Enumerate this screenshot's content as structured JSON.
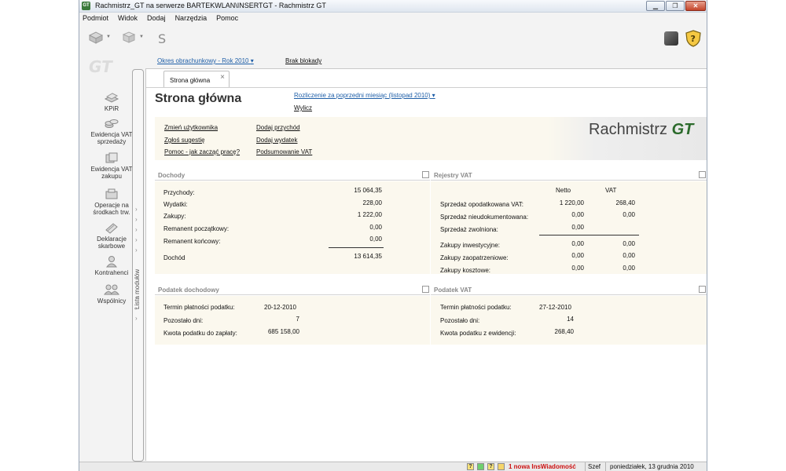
{
  "window": {
    "title": "Rachmistrz_GT na serwerze BARTEKWLAN\\INSERTGT - Rachmistrz GT",
    "icon": "gt-app-icon",
    "controls": [
      "minimize",
      "maximize",
      "close"
    ]
  },
  "menu": [
    "Podmiot",
    "Widok",
    "Dodaj",
    "Narzędzia",
    "Pomoc"
  ],
  "sidebar": {
    "logo": "GT",
    "items": [
      {
        "label": "KPiR",
        "icon": "ledger-icon"
      },
      {
        "label": "Ewidencja VAT sprzedaży",
        "icon": "coins-icon"
      },
      {
        "label": "Ewidencja VAT zakupu",
        "icon": "documents-icon"
      },
      {
        "label": "Operacje na środkach trw.",
        "icon": "fixed-assets-icon"
      },
      {
        "label": "Deklaracje skarbowe",
        "icon": "declarations-icon"
      },
      {
        "label": "Kontrahenci",
        "icon": "contractor-icon"
      },
      {
        "label": "Wspólnicy",
        "icon": "partners-icon"
      }
    ],
    "handle_label": "Lista modułów"
  },
  "period_bar": {
    "period_link": "Okres obrachunkowy - Rok 2010",
    "block_link": "Brak blokady"
  },
  "tab": {
    "label": "Strona główna"
  },
  "page": {
    "title": "Strona główna",
    "settle_link": "Rozliczenie za poprzedni miesiąc (listopad 2010)",
    "calc_link": "Wylicz"
  },
  "quick_links": {
    "col1": [
      "Zmień użytkownika",
      "Zgłoś sugestię",
      "Pomoc - jak zacząć pracę?"
    ],
    "col2": [
      "Dodaj przychód",
      "Dodaj wydatek",
      "Podsumowanie VAT"
    ]
  },
  "brand": {
    "text": "Rachmistrz",
    "mark": "GT"
  },
  "income": {
    "title": "Dochody",
    "rows": [
      {
        "label": "Przychody:",
        "value": "15 064,35"
      },
      {
        "label": "Wydatki:",
        "value": "228,00"
      },
      {
        "label": "Zakupy:",
        "value": "1 222,00"
      },
      {
        "label": "Remanent początkowy:",
        "value": "0,00"
      },
      {
        "label": "Remanent końcowy:",
        "value": "0,00"
      }
    ],
    "total_label": "Dochód",
    "total_value": "13 614,35"
  },
  "vat_registers": {
    "title": "Rejestry VAT",
    "col_net": "Netto",
    "col_vat": "VAT",
    "sales": [
      {
        "label": "Sprzedaż opodatkowana VAT:",
        "net": "1 220,00",
        "vat": "268,40"
      },
      {
        "label": "Sprzedaż nieudokumentowana:",
        "net": "0,00",
        "vat": "0,00"
      },
      {
        "label": "Sprzedaż zwolniona:",
        "net": "0,00",
        "vat": ""
      }
    ],
    "purchases": [
      {
        "label": "Zakupy inwestycyjne:",
        "net": "0,00",
        "vat": "0,00"
      },
      {
        "label": "Zakupy zaopatrzeniowe:",
        "net": "0,00",
        "vat": "0,00"
      },
      {
        "label": "Zakupy kosztowe:",
        "net": "0,00",
        "vat": "0,00"
      }
    ]
  },
  "income_tax": {
    "title": "Podatek dochodowy",
    "rows": [
      {
        "label": "Termin płatności podatku:",
        "value": "20-12-2010"
      },
      {
        "label": "Pozostało dni:",
        "value": "7"
      },
      {
        "label": "Kwota podatku do zapłaty:",
        "value": "685 158,00"
      }
    ]
  },
  "vat_tax": {
    "title": "Podatek VAT",
    "rows": [
      {
        "label": "Termin płatności podatku:",
        "value": "27-12-2010"
      },
      {
        "label": "Pozostało dni:",
        "value": "14"
      },
      {
        "label": "Kwota podatku z ewidencji:",
        "value": "268,40"
      }
    ]
  },
  "status": {
    "help": "?",
    "messages": "1 nowa InsWiadomość",
    "user": "Szef",
    "date": "poniedziałek, 13 grudnia 2010"
  },
  "colors": {
    "panel": "#fbf8ee",
    "link": "#1f5fa8",
    "brand_green": "#2c6b2c",
    "alert_red": "#cc1111"
  }
}
